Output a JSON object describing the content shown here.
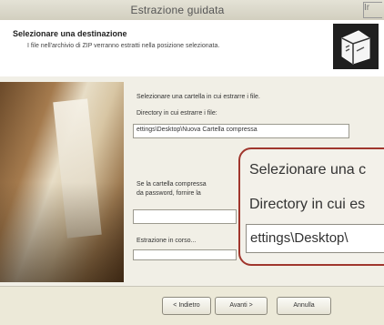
{
  "window": {
    "title": "Estrazione guidata",
    "corner_text": "Ir"
  },
  "header": {
    "title": "Selezionare una destinazione",
    "subtitle": "I file nell'archivio di ZIP verranno estratti nella posizione selezionata."
  },
  "content": {
    "intro": "Selezionare una cartella in cui estrarre i file.",
    "directory_label": "Directory in cui estrarre i file:",
    "directory_value": "ettings\\Desktop\\Nuova Cartella compressa",
    "password_line1": "Se la cartella compressa",
    "password_line2": "da password, fornire la",
    "progress_label": "Estrazione in corso...",
    "progress_value": 0
  },
  "zoom": {
    "line1": "Selezionare una c",
    "line2": "Directory in cui es",
    "field_value": "ettings\\Desktop\\"
  },
  "buttons": {
    "back": "< Indietro",
    "next": "Avanti >",
    "cancel": "Annulla"
  }
}
